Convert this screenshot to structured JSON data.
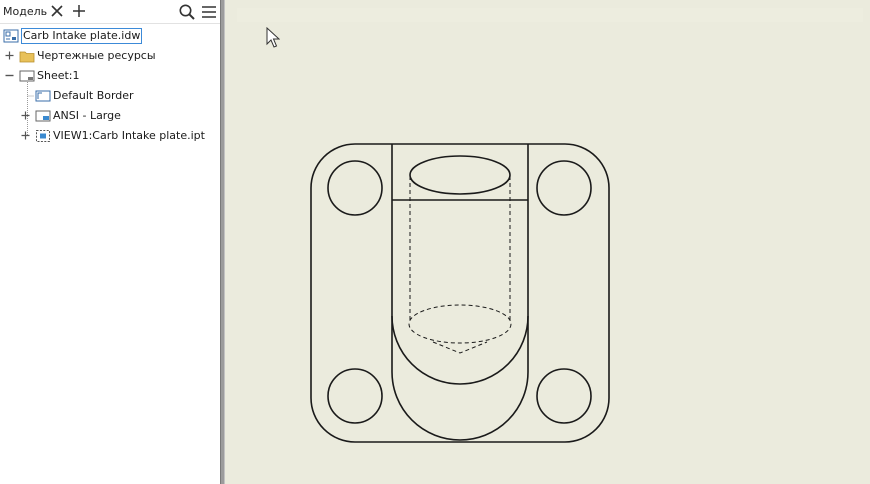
{
  "browser": {
    "tab_label": "Модель",
    "close_tip": "close",
    "add_tip": "add",
    "search_icon": "search-icon",
    "menu_icon": "hamburger-menu-icon"
  },
  "tree": {
    "items": [
      {
        "label": "Carb Intake plate.idw",
        "icon": "drawing-document-icon",
        "selected": true,
        "expander": "none"
      },
      {
        "label": "Чертежные ресурсы",
        "icon": "folder-icon",
        "selected": false,
        "expander": "plus"
      },
      {
        "label": "Sheet:1",
        "icon": "sheet-icon",
        "selected": false,
        "expander": "minus"
      },
      {
        "label": "Default Border",
        "icon": "border-icon",
        "selected": false,
        "expander": "none"
      },
      {
        "label": "ANSI - Large",
        "icon": "title-block-icon",
        "selected": false,
        "expander": "plus"
      },
      {
        "label": "VIEW1:Carb Intake plate.ipt",
        "icon": "drawing-view-icon",
        "selected": false,
        "expander": "plus"
      }
    ]
  },
  "colors": {
    "canvas": "#ebebdd",
    "selection_border": "#3c8ad8",
    "folder": "#e8c15a",
    "line": "#1a1a1a"
  }
}
